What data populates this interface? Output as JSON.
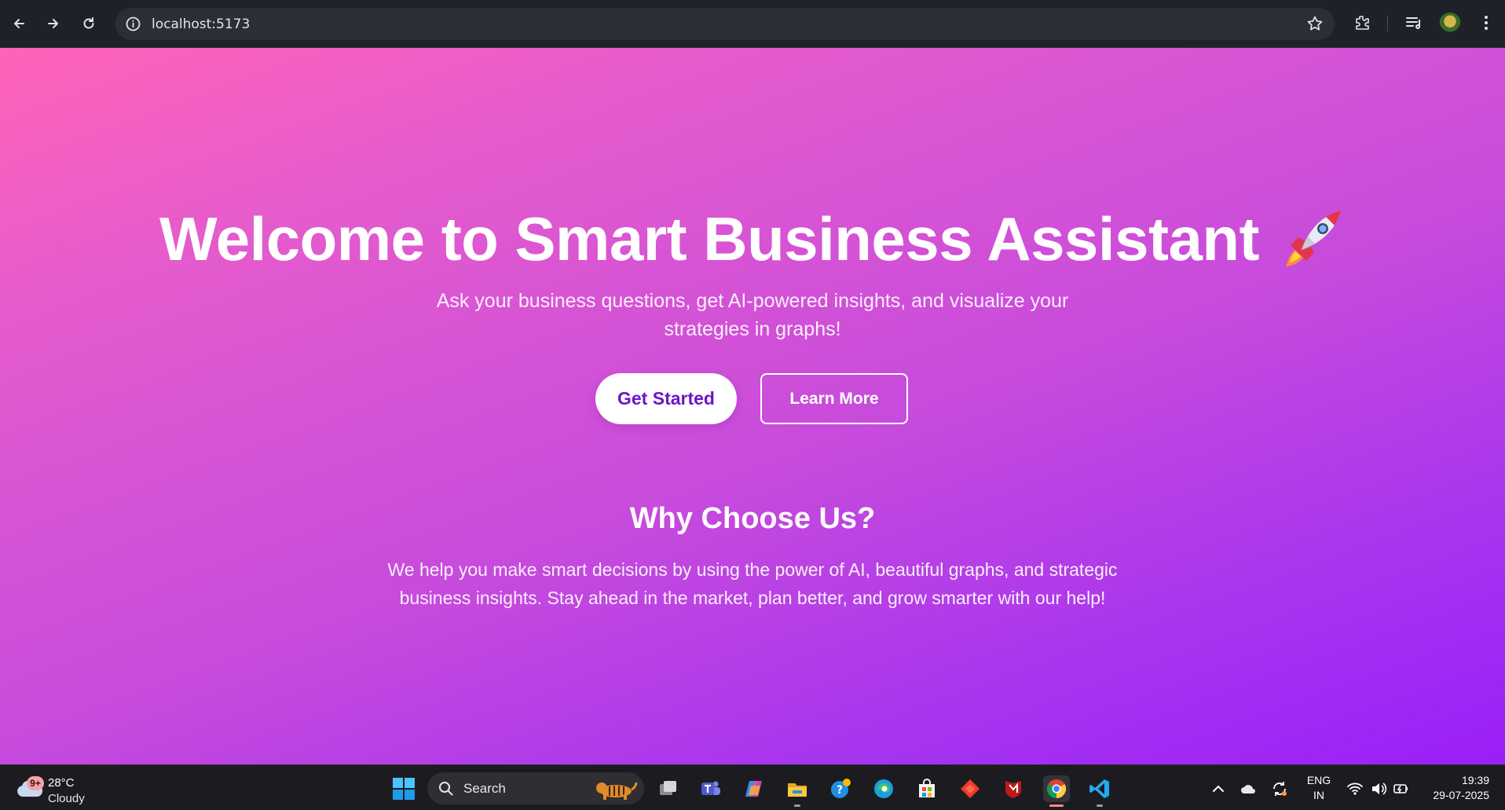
{
  "browser": {
    "url": "localhost:5173"
  },
  "hero": {
    "title": "Welcome to Smart Business Assistant",
    "subtitle": "Ask your business questions, get AI-powered insights, and visualize your strategies in graphs!",
    "primary_button": "Get Started",
    "secondary_button": "Learn More"
  },
  "why": {
    "title": "Why Choose Us?",
    "text": "We help you make smart decisions by using the power of AI, beautiful graphs, and strategic business insights. Stay ahead in the market, plan better, and grow smarter with our help!"
  },
  "taskbar": {
    "weather_badge": "9+",
    "weather_temp": "28°C",
    "weather_condition": "Cloudy",
    "search_label": "Search",
    "lang_line1": "ENG",
    "lang_line2": "IN",
    "time": "19:39",
    "date": "29-07-2025"
  },
  "colors": {
    "gradient_start": "#ff63b8",
    "gradient_end": "#9a1ff8",
    "primary_button_text": "#6a16c9"
  }
}
